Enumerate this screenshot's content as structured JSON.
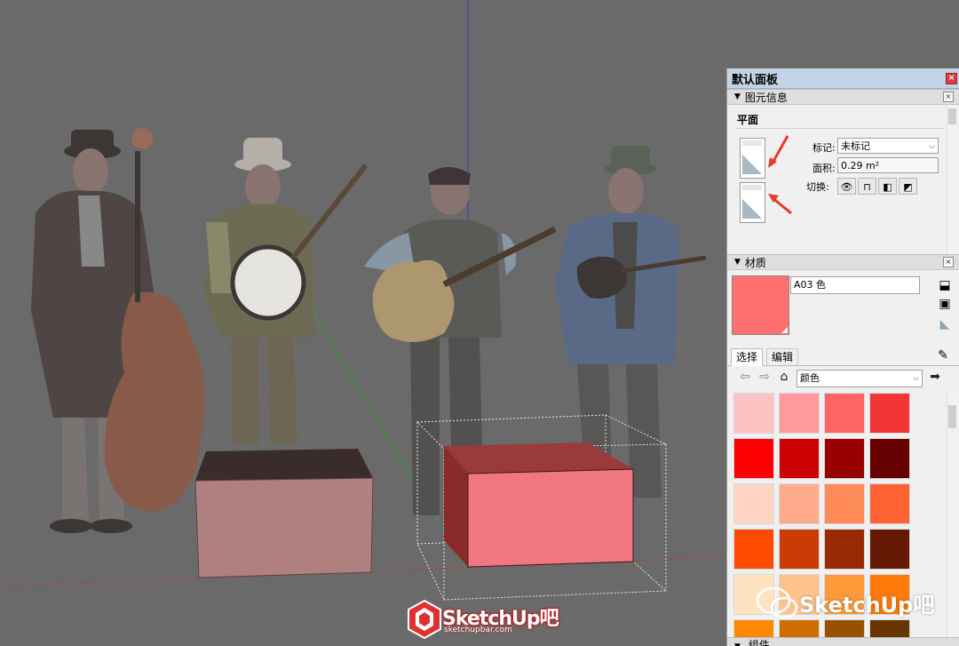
{
  "tray": {
    "title": "默认面板",
    "close_glyph": "×"
  },
  "entity_info": {
    "section_title": "图元信息",
    "entity_type": "平面",
    "tag_label": "标记:",
    "tag_value": "未标记",
    "area_label": "面积:",
    "area_value": "0.29 m²",
    "toggle_label": "切换:",
    "toggles": [
      {
        "icon": "eye-icon",
        "glyph": "👁"
      },
      {
        "icon": "lock-icon",
        "glyph": "🔓"
      },
      {
        "icon": "receive-shadow-icon",
        "glyph": "◧"
      },
      {
        "icon": "cast-shadow-icon",
        "glyph": "◩"
      }
    ],
    "arrow_color": "#e83a2a"
  },
  "materials": {
    "section_title": "材质",
    "current_name": "A03 色",
    "current_color": "#ff6f6f",
    "tabs": [
      "选择",
      "编辑"
    ],
    "collection": "颜色",
    "swatches": [
      "#ffc2c2",
      "#ff9a9a",
      "#ff6565",
      "#f23535",
      "#ff0000",
      "#cc0000",
      "#990000",
      "#660000",
      "#ffd4c4",
      "#ffab8c",
      "#ff8a5a",
      "#ff6233",
      "#ff4a00",
      "#cc3a05",
      "#992a05",
      "#661a05",
      "#ffe2c2",
      "#ffc48c",
      "#ff9a3a",
      "#ff7a08",
      "#ff8800",
      "#cc6e00",
      "#995000",
      "#663500"
    ]
  },
  "components": {
    "section_title": "组件"
  },
  "watermarks": {
    "logo_text": "SketchUp吧",
    "logo_url": "sketchupbar.com",
    "wechat_text": "SketchUp吧"
  }
}
